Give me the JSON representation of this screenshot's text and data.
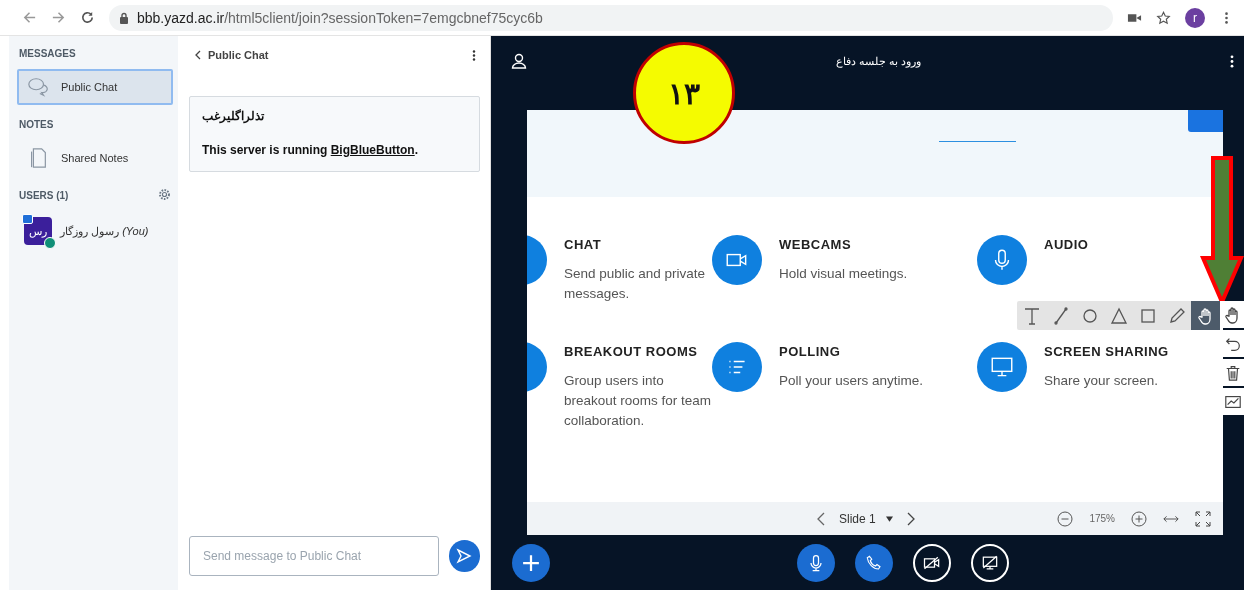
{
  "browser": {
    "url_host": "bbb.yazd.ac.ir",
    "url_path": "/html5client/join?sessionToken=7emgcbnef75cyc6b",
    "profile_initial": "r"
  },
  "sidebar": {
    "messages_heading": "MESSAGES",
    "public_chat": {
      "label": "Public Chat",
      "selected": true
    },
    "notes_heading": "NOTES",
    "shared_notes": {
      "label": "Shared Notes",
      "selected": false
    },
    "users_heading": "USERS (1)",
    "users": [
      {
        "name": "رسول روزگار",
        "you": "(You)",
        "avatar": "رس"
      }
    ]
  },
  "chat": {
    "title": "Public Chat",
    "welcome_title": "تذلراگلیرغب",
    "welcome_prefix": "This server is running ",
    "welcome_link": "BigBlueButton",
    "welcome_suffix": ".",
    "placeholder": "Send message to Public Chat"
  },
  "presentation": {
    "title": "ورود به جلسه دفاع",
    "annotation": "۱۳",
    "features": [
      {
        "kind": "chat",
        "title": "CHAT",
        "text": "Send public and private messages."
      },
      {
        "kind": "webcam",
        "title": "WEBCAMS",
        "text": "Hold visual meetings."
      },
      {
        "kind": "audio",
        "title": "AUDIO"
      },
      {
        "kind": "breakout",
        "title": "BREAKOUT ROOMS",
        "text": "Group users into breakout rooms for team collaboration."
      },
      {
        "kind": "polling",
        "title": "POLLING",
        "text": "Poll your users anytime."
      },
      {
        "kind": "screen",
        "title": "SCREEN SHARING",
        "text": "Share your screen."
      }
    ],
    "slide_label": "Slide 1",
    "zoom": "175%",
    "tools": [
      {
        "kind": "text",
        "selected": false
      },
      {
        "kind": "line",
        "selected": false
      },
      {
        "kind": "ellipse",
        "selected": false
      },
      {
        "kind": "triangle",
        "selected": false
      },
      {
        "kind": "rectangle",
        "selected": false
      },
      {
        "kind": "pencil",
        "selected": false
      },
      {
        "kind": "pan",
        "selected": true
      }
    ]
  }
}
